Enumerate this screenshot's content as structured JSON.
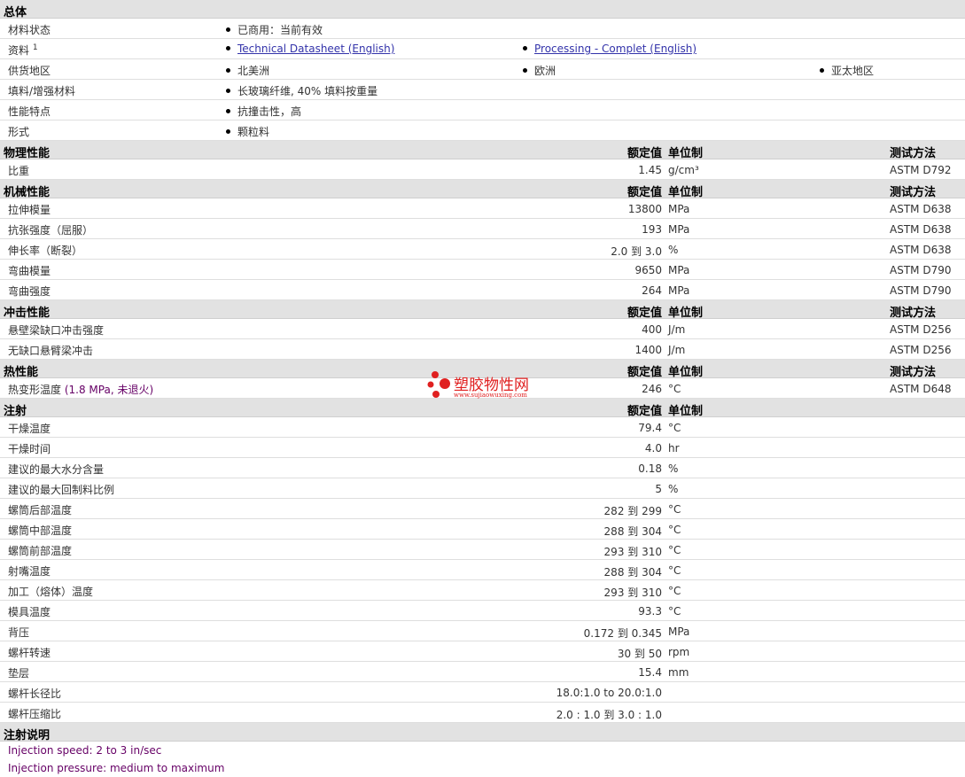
{
  "general": {
    "title": "总体",
    "rows": [
      {
        "label": "材料状态",
        "items": [
          "已商用：当前有效"
        ]
      },
      {
        "label": "资料",
        "sup": "1",
        "links": [
          "Technical Datasheet (English)",
          "Processing - Complet (English)"
        ]
      },
      {
        "label": "供货地区",
        "items": [
          "北美洲",
          "欧洲",
          "亚太地区"
        ]
      },
      {
        "label": "填料/增强材料",
        "items": [
          "长玻璃纤维, 40% 填料按重量"
        ]
      },
      {
        "label": "性能特点",
        "items": [
          "抗撞击性，高"
        ]
      },
      {
        "label": "形式",
        "items": [
          "颗粒料"
        ]
      }
    ]
  },
  "headers": {
    "value": "额定值",
    "unit": "单位制",
    "test": "测试方法"
  },
  "physical": {
    "title": "物理性能",
    "rows": [
      {
        "label": "比重",
        "value": "1.45",
        "unit": "g/cm³",
        "test": "ASTM D792"
      }
    ]
  },
  "mechanical": {
    "title": "机械性能",
    "rows": [
      {
        "label": "拉伸模量",
        "value": "13800",
        "unit": "MPa",
        "test": "ASTM D638"
      },
      {
        "label": "抗张强度（屈服）",
        "value": "193",
        "unit": "MPa",
        "test": "ASTM D638"
      },
      {
        "label": "伸长率（断裂）",
        "value": "2.0 到  3.0",
        "unit": "%",
        "test": "ASTM D638"
      },
      {
        "label": "弯曲模量",
        "value": "9650",
        "unit": "MPa",
        "test": "ASTM D790"
      },
      {
        "label": "弯曲强度",
        "value": "264",
        "unit": "MPa",
        "test": "ASTM D790"
      }
    ]
  },
  "impact": {
    "title": "冲击性能",
    "rows": [
      {
        "label": "悬壁梁缺口冲击强度",
        "value": "400",
        "unit": "J/m",
        "test": "ASTM D256"
      },
      {
        "label": "无缺口悬臂梁冲击",
        "value": "1400",
        "unit": "J/m",
        "test": "ASTM D256"
      }
    ]
  },
  "thermal": {
    "title": "热性能",
    "rows": [
      {
        "label": "热变形温度",
        "label_extra": "(1.8 MPa, 未退火)",
        "value": "246",
        "unit": "°C",
        "test": "ASTM D648"
      }
    ]
  },
  "injection": {
    "title": "注射",
    "rows": [
      {
        "label": "干燥温度",
        "value": "79.4",
        "unit": "°C"
      },
      {
        "label": "干燥时间",
        "value": "4.0",
        "unit": "hr"
      },
      {
        "label": "建议的最大水分含量",
        "value": "0.18",
        "unit": "%"
      },
      {
        "label": "建议的最大回制料比例",
        "value": "5",
        "unit": "%"
      },
      {
        "label": "螺筒后部温度",
        "value": "282 到  299",
        "unit": "°C"
      },
      {
        "label": "螺筒中部温度",
        "value": "288 到  304",
        "unit": "°C"
      },
      {
        "label": "螺筒前部温度",
        "value": "293 到  310",
        "unit": "°C"
      },
      {
        "label": "射嘴温度",
        "value": "288 到  304",
        "unit": "°C"
      },
      {
        "label": "加工（熔体）温度",
        "value": "293 到  310",
        "unit": "°C"
      },
      {
        "label": "模具温度",
        "value": "93.3",
        "unit": "°C"
      },
      {
        "label": "背压",
        "value": "0.172 到  0.345",
        "unit": "MPa"
      },
      {
        "label": "螺杆转速",
        "value": "30 到  50",
        "unit": "rpm"
      },
      {
        "label": "垫层",
        "value": "15.4",
        "unit": "mm"
      },
      {
        "label": "螺杆长径比",
        "value": "18.0:1.0 to 20.0:1.0",
        "unit": ""
      },
      {
        "label": "螺杆压缩比",
        "value": "2.0 : 1.0 到  3.0 : 1.0",
        "unit": ""
      }
    ]
  },
  "injection_notes": {
    "title": "注射说明",
    "lines": [
      "Injection speed: 2 to 3 in/sec",
      "Injection pressure: medium to maximum"
    ]
  },
  "watermark": {
    "cn": "塑胶物性网",
    "en": "www.sujiaowuxing.com"
  }
}
